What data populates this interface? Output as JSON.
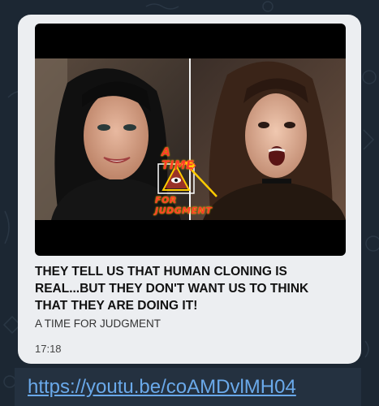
{
  "preview": {
    "title": "THEY TELL US THAT HUMAN CLONING IS REAL...BUT THEY DON'T WANT US TO THINK THAT THEY ARE DOING IT!",
    "channel": "A TIME FOR JUDGMENT",
    "time": "17:18"
  },
  "thumbnail": {
    "logo_top": "A TIME",
    "logo_bottom": "FOR JUDGMENT",
    "logo_icon": "pyramid-eye-axe-icon"
  },
  "message": {
    "link_text": "https://youtu.be/coAMDvlMH04"
  },
  "colors": {
    "background": "#1c2733",
    "card": "#eceef1",
    "link": "#6aa9ea",
    "logo": "#ff3a2a"
  }
}
